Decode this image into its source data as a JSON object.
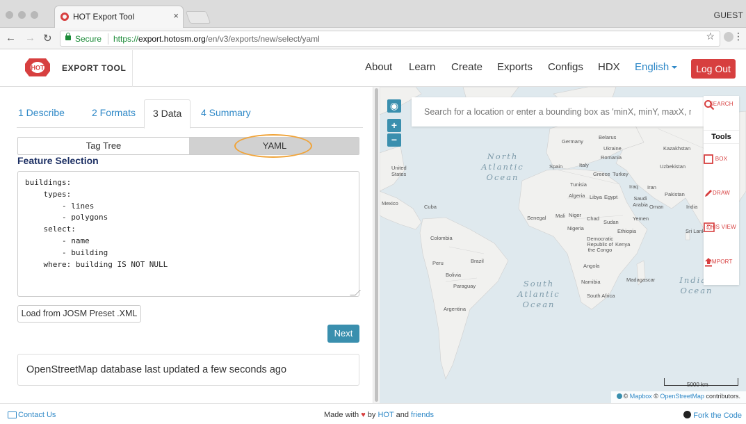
{
  "browser": {
    "tab_title": "HOT Export Tool",
    "tab_close": "×",
    "profile": "GUEST",
    "secure_label": "Secure",
    "url_scheme": "https://",
    "url_host": "export.hotosm.org",
    "url_path": "/en/v3/exports/new/select/yaml"
  },
  "navbar": {
    "brand_badge": "HOT",
    "brand": "EXPORT TOOL",
    "links": [
      "About",
      "Learn",
      "Create",
      "Exports",
      "Configs",
      "HDX"
    ],
    "language": "English",
    "logout": "Log Out"
  },
  "wizard": {
    "tabs": [
      "1 Describe",
      "2 Formats",
      "3 Data",
      "4 Summary"
    ],
    "active_tab": "3 Data",
    "mode_buttons": [
      "Tag Tree",
      "YAML"
    ],
    "selected_mode": "YAML",
    "feature_heading": "Feature Selection",
    "yaml_text": "buildings:\n    types:\n        - lines\n        - polygons\n    select:\n        - name\n        - building\n    where: building IS NOT NULL",
    "josm_button": "Load from JOSM Preset .XML",
    "next_button": "Next",
    "status_text": "OpenStreetMap database last updated a few seconds ago"
  },
  "map": {
    "zoom_in": "+",
    "zoom_out": "−",
    "search_placeholder": "Search for a location or enter a bounding box as 'minX, minY, maxX, maxY'",
    "tools_heading": "Tools",
    "tools": [
      {
        "icon": "search-icon",
        "label": "SEARCH"
      },
      {
        "icon": "box-icon",
        "label": "BOX"
      },
      {
        "icon": "draw-icon",
        "label": "DRAW"
      },
      {
        "icon": "this-view-icon",
        "label": "THIS VIEW"
      },
      {
        "icon": "import-icon",
        "label": "IMPORT"
      }
    ],
    "scale": "5000 km",
    "attribution_mapbox": "Mapbox",
    "attribution_osm": "OpenStreetMap",
    "attribution_suffix": "contributors.",
    "oceans": [
      "North Atlantic Ocean",
      "South Atlantic Ocean",
      "Indian Ocean"
    ],
    "place_labels": {
      "germany": "Germany",
      "belarus": "Belarus",
      "ukraine": "Ukraine",
      "romania": "Romania",
      "kazakhstan": "Kazakhstan",
      "uzbekistan": "Uzbekistan",
      "spain": "Spain",
      "italy": "Italy",
      "greece": "Greece",
      "turkey": "Turkey",
      "tunisia": "Tunisia",
      "iraq": "Iraq",
      "iran": "Iran",
      "algeria": "Algeria",
      "libya": "Libya",
      "egypt": "Egypt",
      "saudi": "Saudi Arabia",
      "oman": "Oman",
      "pakistan": "Pakistan",
      "india": "India",
      "united_states": "United States",
      "mexico": "Mexico",
      "cuba": "Cuba",
      "senegal": "Senegal",
      "mali": "Mali",
      "niger": "Niger",
      "chad": "Chad",
      "sudan": "Sudan",
      "yemen": "Yemen",
      "nigeria": "Nigeria",
      "ethiopia": "Ethiopia",
      "sri_lanka": "Sri Lanka",
      "drc": "Democratic Republic of the Congo",
      "kenya": "Kenya",
      "colombia": "Colombia",
      "peru": "Peru",
      "brazil": "Brazil",
      "bolivia": "Bolivia",
      "paraguay": "Paraguay",
      "angola": "Angola",
      "namibia": "Namibia",
      "madagascar": "Madagascar",
      "south_africa": "South Africa",
      "argentina": "Argentina"
    }
  },
  "footer": {
    "contact": "Contact Us",
    "made_with": "Made with",
    "by": "by",
    "hot": "HOT",
    "and": "and",
    "friends": "friends",
    "fork": "Fork the Code"
  },
  "colors": {
    "accent": "#2e88c7",
    "brand_red": "#d73f3f",
    "primary_button": "#3a8fae",
    "highlight_ring": "#f0a43a"
  }
}
